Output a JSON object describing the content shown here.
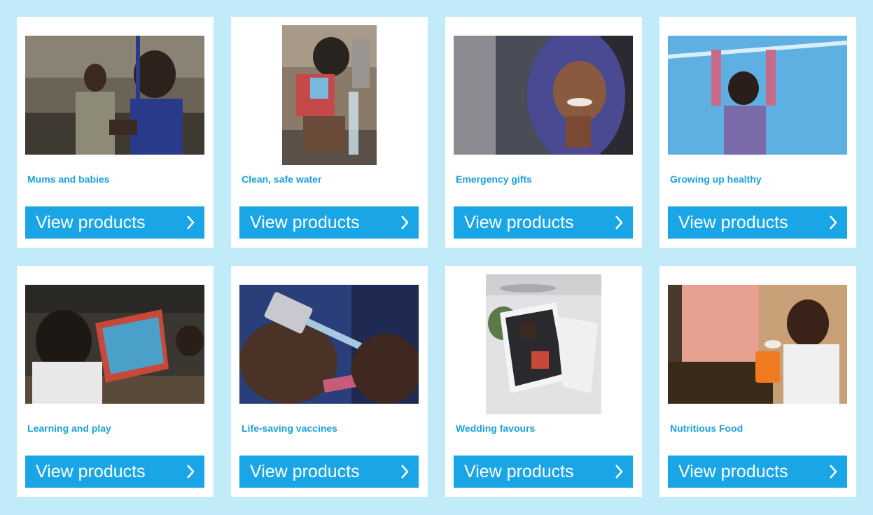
{
  "products": [
    {
      "title": "Mums and babies",
      "button_label": "View products",
      "image": "photo-mum-and-baby",
      "colors": [
        "#6b6356",
        "#2a3a8a",
        "#3a2a22"
      ]
    },
    {
      "title": "Clean, safe water",
      "button_label": "View products",
      "image": "photo-child-drinking-water",
      "colors": [
        "#8a7a6a",
        "#c44a4a",
        "#3a2e28"
      ]
    },
    {
      "title": "Emergency gifts",
      "button_label": "View products",
      "image": "photo-smiling-child-blanket",
      "colors": [
        "#4a4c58",
        "#4a4a92",
        "#6a4a3a"
      ]
    },
    {
      "title": "Growing up healthy",
      "button_label": "View products",
      "image": "photo-child-mosquito-net",
      "colors": [
        "#3a9ad8",
        "#7a6aa8",
        "#2a1e1a"
      ]
    },
    {
      "title": "Learning and play",
      "button_label": "View products",
      "image": "photo-children-reading",
      "colors": [
        "#3a3630",
        "#e8e8e8",
        "#c8483a"
      ]
    },
    {
      "title": "Life-saving vaccines",
      "button_label": "View products",
      "image": "photo-vaccine-vial",
      "colors": [
        "#2a3e7a",
        "#4a3226",
        "#c8c8d0"
      ]
    },
    {
      "title": "Wedding favours",
      "button_label": "View products",
      "image": "photo-wedding-card",
      "colors": [
        "#e2e2e4",
        "#2a2a2e",
        "#5a7a4a"
      ]
    },
    {
      "title": "Nutritious Food",
      "button_label": "View products",
      "image": "photo-child-eating",
      "colors": [
        "#e8a090",
        "#f07a20",
        "#3a2218"
      ]
    }
  ]
}
